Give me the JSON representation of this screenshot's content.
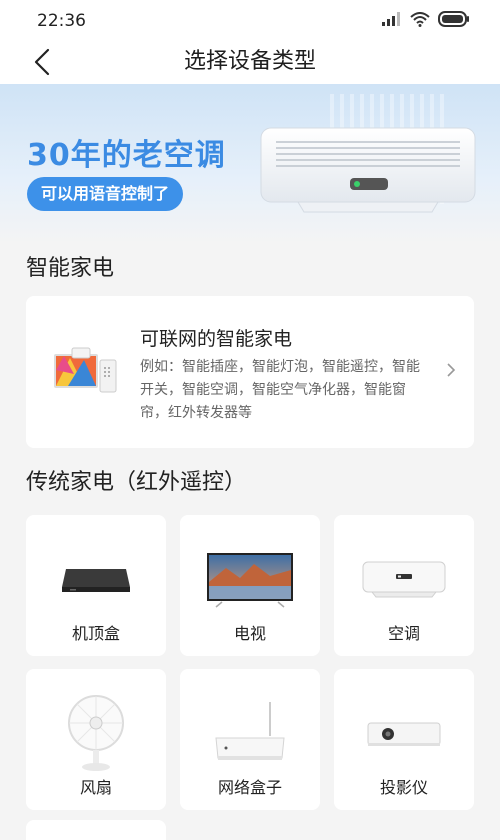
{
  "status": {
    "time": "22:36"
  },
  "nav": {
    "title": "选择设备类型"
  },
  "banner": {
    "heading": "30年的老空调",
    "pill": "可以用语音控制了",
    "illustration_icon": "air-conditioner-icon"
  },
  "smart": {
    "section_title": "智能家电",
    "card": {
      "title": "可联网的智能家电",
      "desc": "例如：智能插座，智能灯泡，智能遥控，智能开关，智能空调，智能空气净化器，智能窗帘，红外转发器等"
    }
  },
  "traditional": {
    "section_title": "传统家电（红外遥控）",
    "items": [
      {
        "label": "机顶盒",
        "icon": "set-top-box-icon"
      },
      {
        "label": "电视",
        "icon": "tv-icon"
      },
      {
        "label": "空调",
        "icon": "air-conditioner-icon"
      },
      {
        "label": "风扇",
        "icon": "fan-icon"
      },
      {
        "label": "网络盒子",
        "icon": "network-box-icon"
      },
      {
        "label": "投影仪",
        "icon": "projector-icon"
      }
    ]
  }
}
